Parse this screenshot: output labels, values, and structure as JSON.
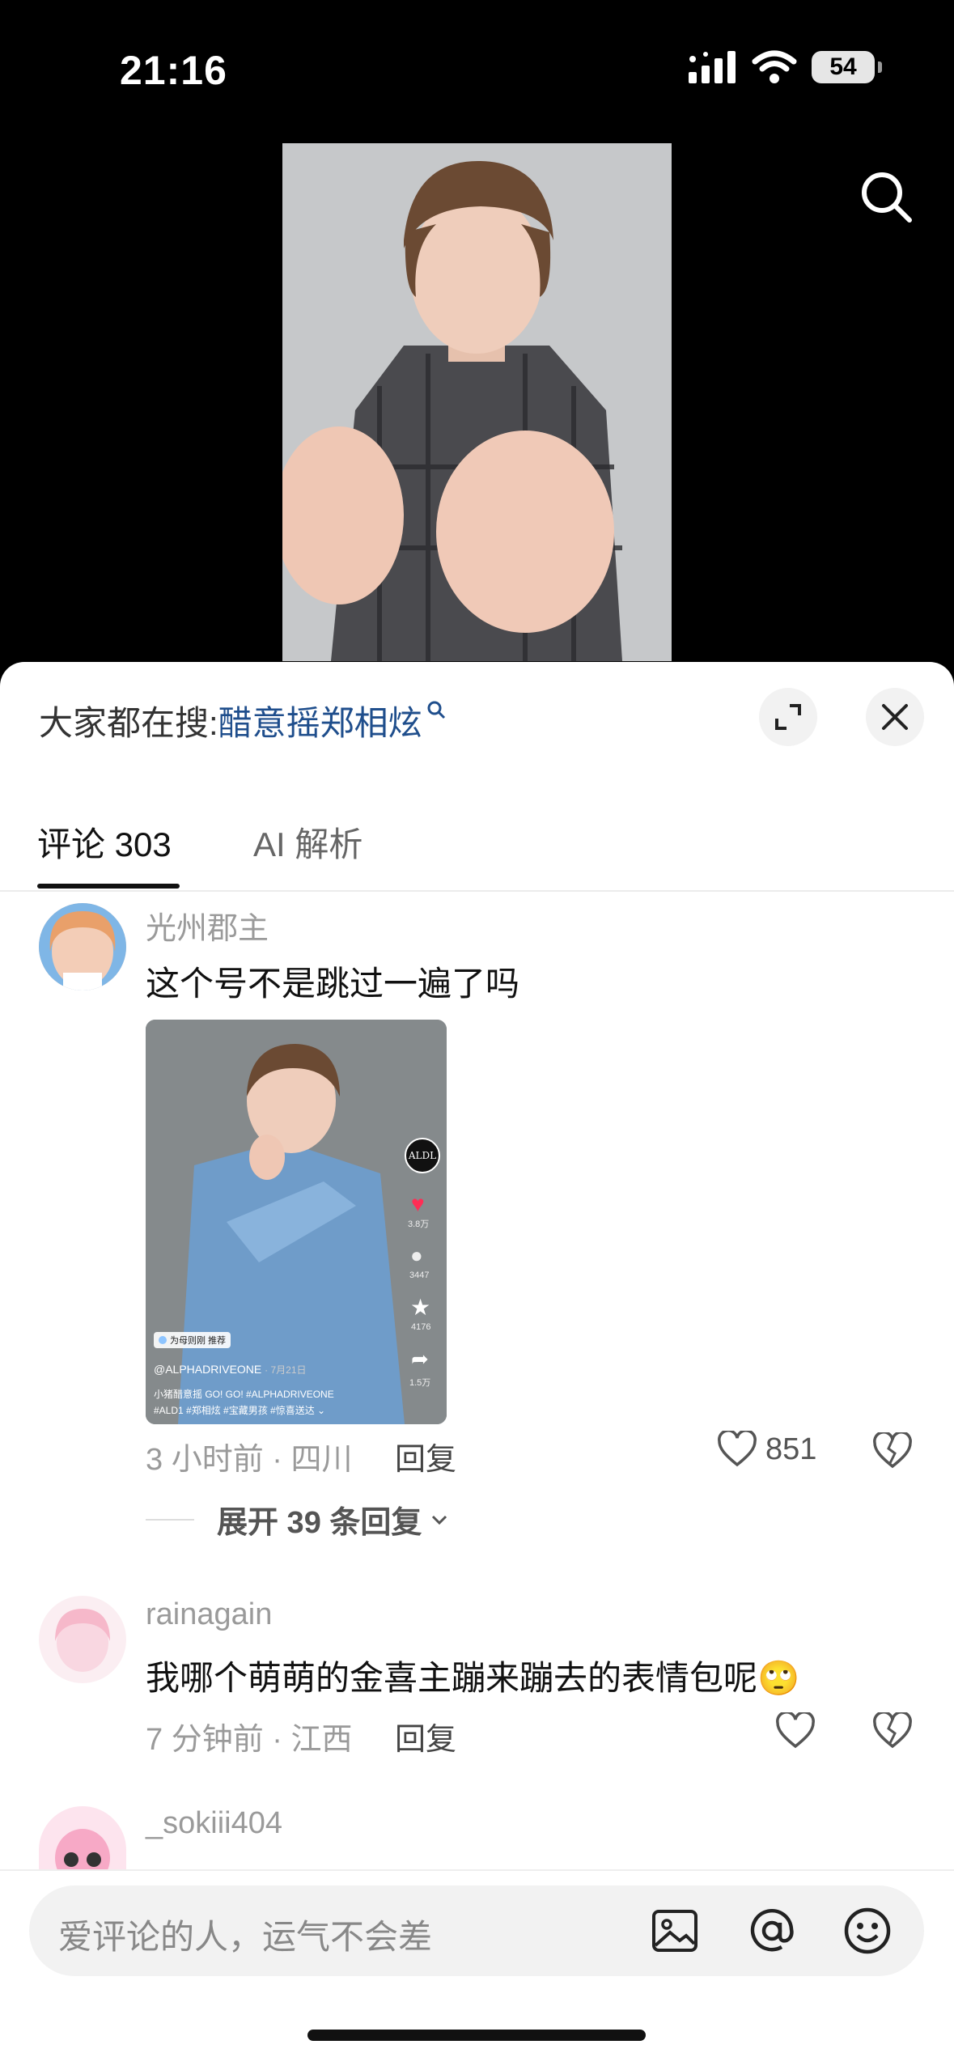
{
  "status_bar": {
    "time": "21:16",
    "battery": "54"
  },
  "video": {
    "search_icon": "search-icon"
  },
  "sheet": {
    "hot_search_prefix": "大家都在搜:",
    "hot_search_keyword": "醋意摇郑相炫",
    "expand_icon": "expand-icon",
    "close_icon": "close-icon"
  },
  "tabs": [
    {
      "label": "评论 303"
    },
    {
      "label": "AI 解析"
    }
  ],
  "comments": [
    {
      "username": "光州郡主",
      "text": "这个号不是跳过一遍了吗",
      "time_location": "3 小时前 · 四川",
      "reply_label": "回复",
      "likes": "851",
      "expand_label": "展开 39 条回复",
      "image": {
        "like_count": "3.8万",
        "comment_count": "3447",
        "star_count": "4176",
        "share_count": "1.5万",
        "tag": "为母则刚 推荐",
        "author": "@ALPHADRIVEONE",
        "date": "· 7月21日",
        "caption_line1": "小猪醋意摇 GO! GO! #ALPHADRIVEONE",
        "caption_line2": "#ALD1 #郑相炫 #宝藏男孩 #惊喜送达 ⌄",
        "badge": "ALDL"
      }
    },
    {
      "username": "rainagain",
      "text": "我哪个萌萌的金喜主蹦来蹦去的表情包呢",
      "emoji": "🙄",
      "time_location": "7 分钟前 · 江西",
      "reply_label": "回复"
    },
    {
      "username": "_sokiii404"
    }
  ],
  "input": {
    "placeholder": "爱评论的人，运气不会差",
    "icons": [
      "image-icon",
      "at-icon",
      "emoji-icon"
    ]
  },
  "colors": {
    "keyword_blue": "#1f4e8c",
    "like_red": "#ff2d55"
  }
}
